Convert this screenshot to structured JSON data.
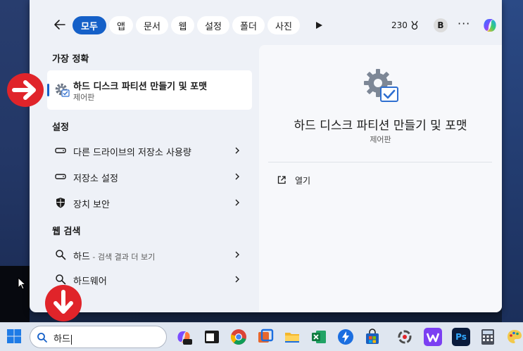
{
  "topbar": {
    "tabs": [
      {
        "label": "모두",
        "active": true
      },
      {
        "label": "앱",
        "active": false
      },
      {
        "label": "문서",
        "active": false
      },
      {
        "label": "웹",
        "active": false
      },
      {
        "label": "설정",
        "active": false
      },
      {
        "label": "폴더",
        "active": false
      },
      {
        "label": "사진",
        "active": false
      }
    ],
    "points": "230",
    "avatar_initial": "B",
    "more_label": "···"
  },
  "best_match": {
    "section_title": "가장 정확",
    "title": "하드 디스크 파티션 만들기 및 포맷",
    "subtitle": "제어판"
  },
  "settings": {
    "section_title": "설정",
    "items": [
      {
        "label": "다른 드라이브의 저장소 사용량",
        "icon": "drive-icon"
      },
      {
        "label": "저장소 설정",
        "icon": "drive-icon"
      },
      {
        "label": "장치 보안",
        "icon": "shield-icon"
      }
    ]
  },
  "web_search": {
    "section_title": "웹 검색",
    "items": [
      {
        "label": "하드",
        "suffix": " - 검색 결과 더 보기",
        "icon": "search-icon"
      },
      {
        "label": "하드웨어",
        "suffix": "",
        "icon": "search-icon"
      }
    ]
  },
  "preview": {
    "title": "하드 디스크 파티션 만들기 및 포맷",
    "subtitle": "제어판",
    "actions": [
      {
        "label": "열기",
        "icon": "open-external-icon"
      }
    ]
  },
  "taskbar": {
    "search_value": "하드",
    "apps": [
      "copilot-pre-icon",
      "terminal-icon",
      "chrome-icon",
      "snipping-icon",
      "file-explorer-icon",
      "excel-icon",
      "power-automate-icon",
      "store-icon",
      "media-icon",
      "wordpad-icon",
      "photoshop-icon",
      "calculator-icon",
      "paint-icon"
    ],
    "photoshop_label": "Ps"
  },
  "colors": {
    "accent": "#1560c8",
    "annotation_red": "#e0242a",
    "panel_bg": "#eef1f7"
  }
}
